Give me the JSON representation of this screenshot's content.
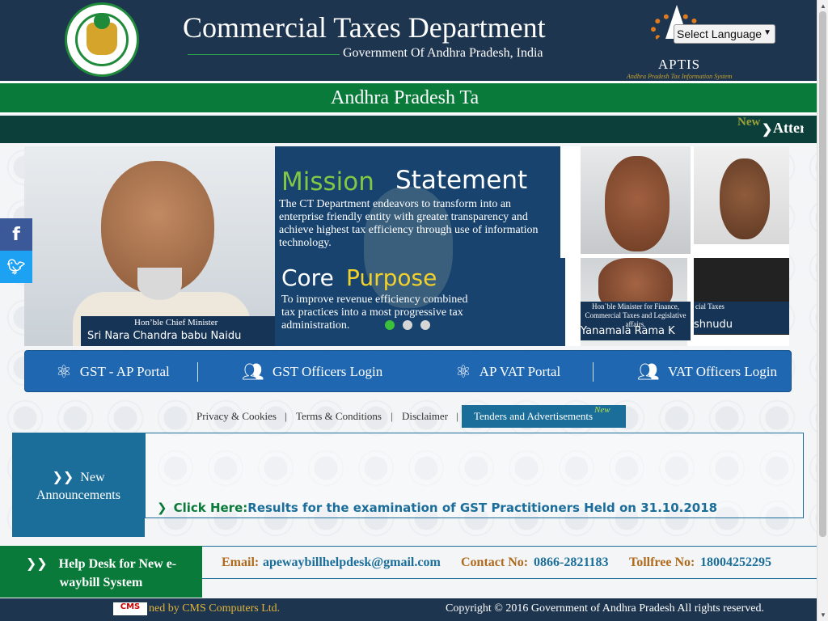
{
  "header": {
    "title": "Commercial Taxes Department",
    "subtitle": "Government Of Andhra Pradesh, India",
    "aptis": "APTIS",
    "aptis_tagline": "Andhra Pradesh Tax Information System",
    "language_select": "Select Language"
  },
  "banner": {
    "title": "Andhra Pradesh Ta"
  },
  "marquee": {
    "new_badge": "New",
    "text": "Atter"
  },
  "slider": {
    "cm_role": "Hon’ble Chief Minister",
    "cm_name": "Sri Nara Chandra babu Naidu",
    "mission_word1": "Mission",
    "mission_word2": "Statement",
    "mission_text": "The CT Department endeavors to transform into an enterprise friendly entity with greater transparency and achieve highest tax efficiency through use of information technology.",
    "core_word1": "Core",
    "core_word2": "Purpose",
    "core_text": "To improve revenue efficiency combined with best tax practices into a most progressive tax administration.",
    "minister_role": "Hon`ble Minister for Finance, Commercial Taxes and Legislative affairs.",
    "minister_name": "Yanamala Rama K",
    "minister2_role": "cial Taxes",
    "minister2_name": "shnudu",
    "sri_fragment": "Sri"
  },
  "portal_bar": {
    "items": [
      {
        "label": "GST - AP Portal",
        "icon": "atom-icon"
      },
      {
        "label": "GST Officers Login",
        "icon": "users-icon"
      },
      {
        "label": "AP VAT Portal",
        "icon": "atom-icon"
      },
      {
        "label": "VAT Officers Login",
        "icon": "users-icon"
      }
    ]
  },
  "links": {
    "privacy": "Privacy & Cookies",
    "terms": "Terms & Conditions",
    "disclaimer": "Disclaimer",
    "tenders": "Tenders and Advertisements",
    "tenders_new": "New"
  },
  "announcements": {
    "label_line1": "New",
    "label_line2": "Announcements",
    "item_prefix": "Click Here:",
    "item_text": "Results for the examination of GST Practitioners Held on 31.10.2018"
  },
  "helpdesk": {
    "title_line1": "Help Desk for New e-",
    "title_line2": "waybill System",
    "email_label": "Email:",
    "email": "apewaybillhelpdesk@gmail.com",
    "contact_label": "Contact No:",
    "contact": "0866-2821183",
    "tollfree_label": "Tollfree No:",
    "tollfree": "18004252295"
  },
  "footer": {
    "logo": "CMS",
    "developed": "ned by CMS Computers Ltd.",
    "copyright": "Copyright © 2016 Government of Andhra Pradesh All rights reserved."
  },
  "colors": {
    "header_bg": "#1e3550",
    "green": "#0a7a3a",
    "blue": "#1f67b0",
    "teal": "#1b6e9a"
  }
}
